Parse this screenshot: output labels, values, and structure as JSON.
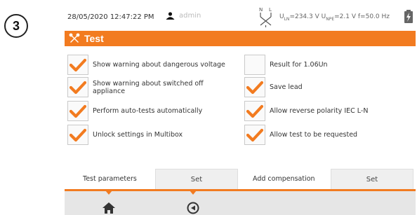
{
  "step": "3",
  "status": {
    "datetime": "28/05/2020 12:47:22 PM",
    "user": "admin",
    "ulnPrefix": "U",
    "ulnSub": "LN",
    "ulnValue": "=234.3 V",
    "unpePrefix": "U",
    "unpeSub": "NPE",
    "unpeValue": "=2.1 V",
    "freq": "f=50.0 Hz",
    "plug_letters": {
      "n": "N",
      "l": "L"
    }
  },
  "title": "Test",
  "accent_color": "#f27b20",
  "options": [
    {
      "label": "Show warning about dangerous voltage",
      "checked": true
    },
    {
      "label": "Result for 1.06Un",
      "checked": false
    },
    {
      "label": "Show warning about switched off appliance",
      "checked": true
    },
    {
      "label": "Save lead",
      "checked": true
    },
    {
      "label": "Perform auto-tests automatically",
      "checked": true
    },
    {
      "label": "Allow reverse polarity IEC L-N",
      "checked": true
    },
    {
      "label": "Unlock settings in Multibox",
      "checked": true
    },
    {
      "label": "Allow test to be requested",
      "checked": true
    }
  ],
  "settings": {
    "test_parameters": {
      "label": "Test parameters",
      "button": "Set"
    },
    "add_compensation": {
      "label": "Add compensation",
      "button": "Set"
    }
  },
  "nav": {
    "home_icon": "home-icon",
    "back_icon": "back-icon"
  }
}
